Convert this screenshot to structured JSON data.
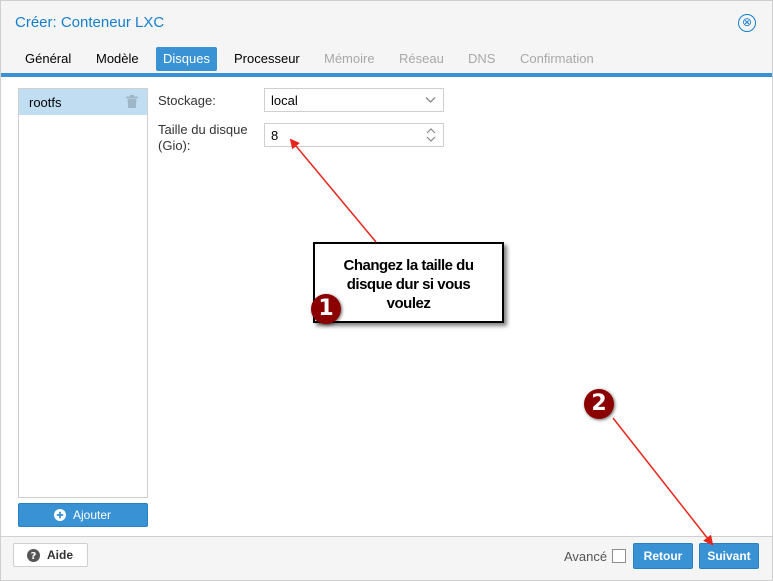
{
  "window": {
    "title": "Créer: Conteneur LXC",
    "close_glyph": "⊗"
  },
  "tabs": [
    {
      "label": "Général",
      "state": "normal"
    },
    {
      "label": "Modèle",
      "state": "normal"
    },
    {
      "label": "Disques",
      "state": "active"
    },
    {
      "label": "Processeur",
      "state": "normal"
    },
    {
      "label": "Mémoire",
      "state": "disabled"
    },
    {
      "label": "Réseau",
      "state": "disabled"
    },
    {
      "label": "DNS",
      "state": "disabled"
    },
    {
      "label": "Confirmation",
      "state": "disabled"
    }
  ],
  "disks": {
    "items": [
      {
        "label": "rootfs",
        "icon": "trash-icon"
      }
    ],
    "add_label": "Ajouter",
    "add_icon": "plus-circle-icon"
  },
  "form": {
    "storage_label": "Stockage:",
    "storage_value": "local",
    "disk_size_label_line1": "Taille du disque",
    "disk_size_label_line2": "(Gio):",
    "disk_size_value": "8"
  },
  "annotations": {
    "callout_line1": "Changez la taille du",
    "callout_line2": "disque dur si vous",
    "callout_line3": "voulez",
    "badge1": "1",
    "badge2": "2",
    "badge_color": "#8b0000",
    "arrow_color": "#e8261c"
  },
  "footer": {
    "help_label": "Aide",
    "help_icon": "question-circle-icon",
    "advanced_label": "Avancé",
    "advanced_checked": false,
    "back_label": "Retour",
    "next_label": "Suivant"
  },
  "colors": {
    "accent": "#3892d4",
    "title": "#157fcc",
    "selection": "#c1ddf1",
    "disabled_text": "#a8a8a8"
  }
}
